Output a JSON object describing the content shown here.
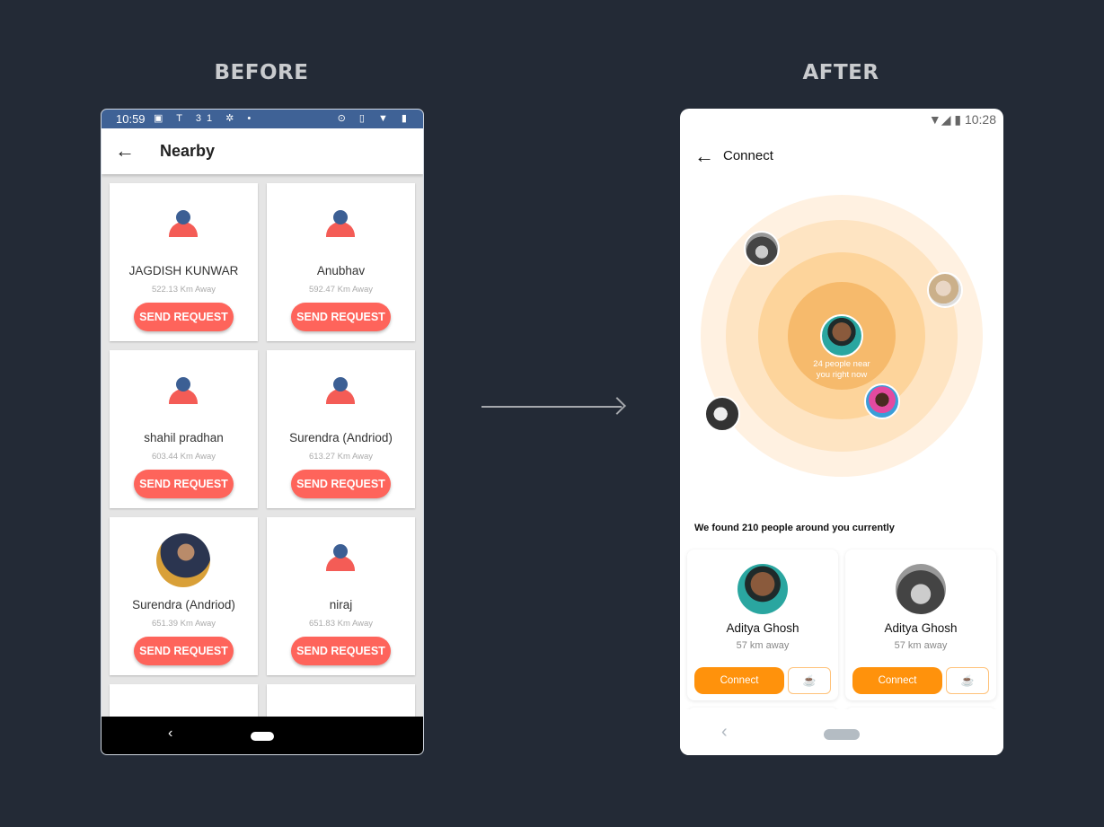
{
  "labels": {
    "before": "BEFORE",
    "after": "AFTER"
  },
  "before": {
    "status_bar": {
      "time": "10:59",
      "left_icons": "▣ T 31 ✲ •",
      "right_icons": "⊙ ▯ ▼ ▮"
    },
    "app_bar": {
      "title": "Nearby",
      "back_icon": "←"
    },
    "cards": [
      {
        "name": "JAGDISH KUNWAR",
        "distance": "522.13 Km Away",
        "button": "SEND REQUEST",
        "avatar": "default"
      },
      {
        "name": "Anubhav",
        "distance": "592.47 Km Away",
        "button": "SEND REQUEST",
        "avatar": "default"
      },
      {
        "name": "shahil pradhan",
        "distance": "603.44 Km Away",
        "button": "SEND REQUEST",
        "avatar": "default"
      },
      {
        "name": "Surendra (Andriod)",
        "distance": "613.27 Km Away",
        "button": "SEND REQUEST",
        "avatar": "default"
      },
      {
        "name": "Surendra (Andriod)",
        "distance": "651.39 Km Away",
        "button": "SEND REQUEST",
        "avatar": "photo"
      },
      {
        "name": "niraj",
        "distance": "651.83 Km Away",
        "button": "SEND REQUEST",
        "avatar": "default"
      }
    ],
    "nav": {
      "back": "‹"
    },
    "colors": {
      "status_bar": "#3f6296",
      "button": "#fe645b"
    }
  },
  "after": {
    "status_bar": {
      "time": "10:28",
      "icons": "▼◢ ▮"
    },
    "app_bar": {
      "title": "Connect",
      "back_icon": "←"
    },
    "radar": {
      "center_text_line1": "24 people near",
      "center_text_line2": "you right now"
    },
    "found_text": "We found 210 people around you currently",
    "cards": [
      {
        "name": "Aditya Ghosh",
        "distance": "57 km away",
        "button": "Connect"
      },
      {
        "name": "Aditya Ghosh",
        "distance": "57 km away",
        "button": "Connect"
      }
    ],
    "nav": {
      "back": "‹"
    },
    "colors": {
      "accent": "#ff920c"
    }
  }
}
